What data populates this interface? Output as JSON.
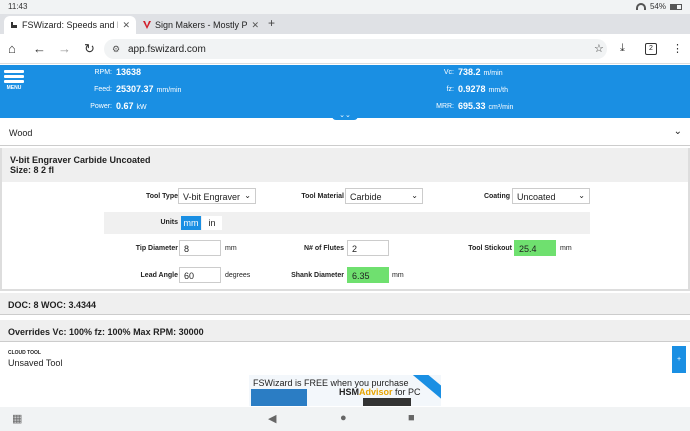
{
  "status": {
    "time": "11:43",
    "battery": "54%"
  },
  "tabs": [
    {
      "title": "FSWizard: Speeds and Feeds",
      "close": "✕"
    },
    {
      "title": "Sign Makers - Mostly Printed",
      "close": "✕"
    }
  ],
  "url": "app.fswizard.com",
  "tab_count": "2",
  "header": {
    "menu_label": "MENU",
    "rpm_label": "RPM:",
    "rpm": "13638",
    "feed_label": "Feed:",
    "feed": "25307.37",
    "feed_unit": "mm/min",
    "power_label": "Power:",
    "power": "0.67",
    "power_unit": "kW",
    "vc_label": "Vc:",
    "vc": "738.2",
    "vc_unit": "m/min",
    "fz_label": "fz:",
    "fz": "0.9278",
    "fz_unit": "mm/th",
    "mrr_label": "MRR:",
    "mrr": "695.33",
    "mrr_unit": "cm³/min"
  },
  "material": "Wood",
  "tool": {
    "title": "V-bit Engraver Carbide Uncoated",
    "size": "Size: 8 2 fl",
    "type_label": "Tool Type",
    "type": "V-bit Engraver",
    "material_label": "Tool Material",
    "material": "Carbide",
    "coating_label": "Coating",
    "coating": "Uncoated",
    "units_label": "Units",
    "unit_mm": "mm",
    "unit_in": "in",
    "tip_label": "Tip Diameter",
    "tip": "8",
    "tip_unit": "mm",
    "flutes_label": "N# of Flutes",
    "flutes": "2",
    "stickout_label": "Tool Stickout",
    "stickout": "25.4",
    "stickout_unit": "mm",
    "angle_label": "Lead Angle",
    "angle": "60",
    "angle_unit": "degrees",
    "shank_label": "Shank Diameter",
    "shank": "6.35",
    "shank_unit": "mm"
  },
  "doc_strip": "DOC: 8 WOC: 3.4344",
  "overrides_strip": "Overrides Vc: 100% fz: 100% Max RPM: 30000",
  "cloud": {
    "label": "CLOUD TOOL",
    "value": "Unsaved Tool"
  },
  "ad": {
    "line1": "FSWizard is FREE when you purchase",
    "brand_a": "HSM",
    "brand_b": "Advisor",
    "brand_c": " for PC"
  },
  "colors": {
    "accent": "#1a8fe3",
    "highlight": "#6fe06f"
  }
}
